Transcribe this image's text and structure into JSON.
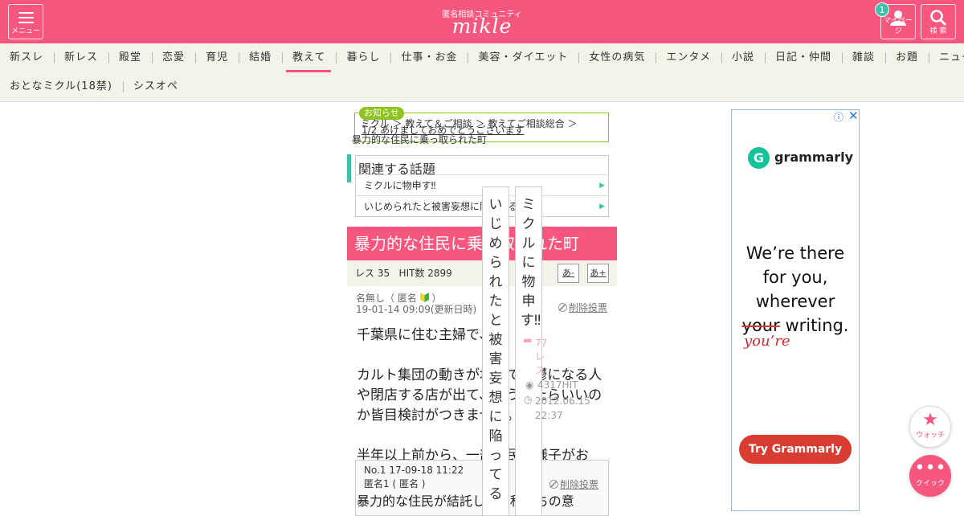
{
  "header": {
    "tagline": "匿名相談コミュニティ",
    "logo": "mikle",
    "menu_label": "メニュー",
    "mypage_label": "マイページ",
    "mypage_badge": "1",
    "search_label": "検 索"
  },
  "nav": {
    "row1": [
      "新スレ",
      "新レス",
      "殿堂",
      "恋愛",
      "育児",
      "結婚",
      "教えて",
      "暮らし",
      "仕事・お金",
      "美容・ダイエット",
      "女性の病気",
      "エンタメ",
      "小説",
      "日記・仲間",
      "雑談",
      "お題",
      "ニュース"
    ],
    "row2": [
      "おとなミクル(18禁)",
      "シスオペ"
    ],
    "active": "教えて"
  },
  "notice": {
    "tag": "お知らせ",
    "breadcrumb": "ミクル ＞ 教えて＆ご相談 ＞ 教えてご相談総合 ＞",
    "link": "1/2 あけましておめでとうございます",
    "crumb_title": "暴力的な住民に乗っ取られた町"
  },
  "related": {
    "title": "関連する話題",
    "items": [
      "ミクルに物申す‼︎",
      "いじめられたと被害妄想に陥ってる"
    ]
  },
  "thread": {
    "title": "暴力的な住民に乗っ取られた町",
    "res_count": "レス 35",
    "hit_count": "HIT数 2899",
    "font_small": "あ-",
    "font_large": "あ+",
    "author": "名無し（ 匿名 ",
    "author_end": "）",
    "date": "19-01-14 09:09(更新日時)",
    "delete_vote": "削除投票",
    "paragraphs": [
      "千葉県に住む主婦で、",
      "カルト集団の動きが地域で、鬱になる人や閉店する店が出て、どうしたらいいのか皆目検討がつきません。",
      "半年以上前から、一部住民の様子がお"
    ],
    "reply_no": "No.1 17-09-18 11:22",
    "reply_author": "匿名1 ( 匿名 )",
    "reply_delete": "削除投票",
    "reply_text": "暴力的な住民が結託して、私たちの意"
  },
  "vertical_cards": [
    {
      "text": "いじめられたと被害妄想に陥ってる"
    },
    {
      "text": "ミクルに物申す‼︎",
      "res": "77レス",
      "hit": "4317HIT",
      "date": "2012.06.15 22:37"
    }
  ],
  "ad": {
    "brand": "grammarly",
    "line1": "We’re there",
    "line2": "for you,",
    "line3": "wherever",
    "strike": "your",
    "line4": " writing.",
    "correction": "you’re",
    "cta": "Try Grammarly"
  },
  "fabs": {
    "watch": "ウォッチ",
    "quick": "クイック"
  },
  "colors": {
    "brand": "#f7577f",
    "accent": "#3cc2a8",
    "notice": "#8fc31f",
    "nav_bg": "#f3f3ea"
  }
}
